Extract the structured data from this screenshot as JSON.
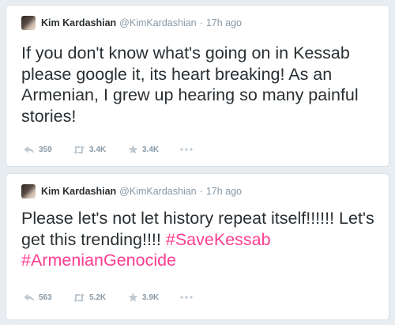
{
  "tweets": [
    {
      "author_name": "Kim Kardashian",
      "handle": "@KimKardashian",
      "separator": "·",
      "time": "17h ago",
      "text": "If you don't know what's going on in Kessab please google it, its heart breaking! As an Armenian, I grew up hearing so many painful stories!",
      "hashtags": [],
      "replies": "359",
      "retweets": "3.4K",
      "favorites": "3.4K"
    },
    {
      "author_name": "Kim Kardashian",
      "handle": "@KimKardashian",
      "separator": "·",
      "time": "17h ago",
      "text": "Please let's not let history repeat itself!!!!!! Let's get this trending!!!!",
      "hashtags": [
        "#SaveKessab",
        "#ArmenianGenocide"
      ],
      "replies": "563",
      "retweets": "5.2K",
      "favorites": "3.9K"
    }
  ],
  "colors": {
    "hashtag": "#ff3d8f",
    "meta": "#8899a6",
    "text": "#292f33",
    "background": "#e8edf1"
  },
  "icons": {
    "reply": "reply-icon",
    "retweet": "retweet-icon",
    "favorite": "star-icon",
    "more": "more-icon"
  }
}
